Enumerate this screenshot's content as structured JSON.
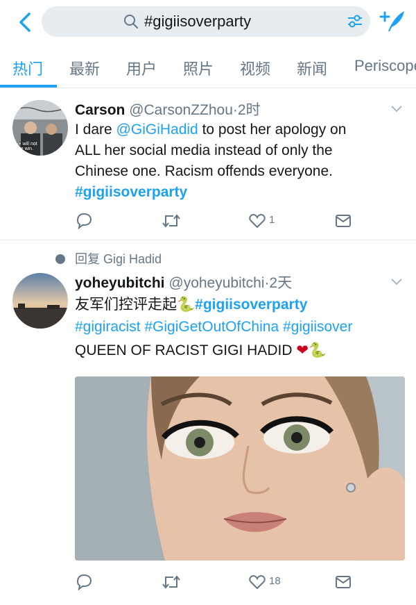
{
  "search": {
    "query": "#gigiisoverparty"
  },
  "tabs": [
    {
      "label": "热门"
    },
    {
      "label": "最新"
    },
    {
      "label": "用户"
    },
    {
      "label": "照片"
    },
    {
      "label": "视频"
    },
    {
      "label": "新闻"
    },
    {
      "label": "Periscope"
    }
  ],
  "tweets": [
    {
      "name": "Carson",
      "handle": "@CarsonZZhou",
      "time": "·2时",
      "avatar_caption": "We will not hate win.",
      "lines": [
        {
          "before": "I dare ",
          "mention": "@GiGiHadid",
          "after": " to post her apology on"
        },
        {
          "text": "ALL her social media instead of only the"
        },
        {
          "text": "Chinese one. Racism offends everyone."
        },
        {
          "hashtag": "#gigiisoverparty"
        }
      ],
      "likes": "1"
    },
    {
      "reply_to": "回复 Gigi Hadid",
      "name": "yoheyubitchi",
      "handle": "@yoheyubitchi",
      "time": "·2天",
      "lines": [
        {
          "before": "友军们控评走起",
          "emoji": "🐍",
          "hashtag": "#gigiisoverparty"
        },
        {
          "text": "#gigiracist #GigiGetOutOfChina #gigiisover"
        },
        {
          "text": "QUEEN OF RACIST GIGI HADID",
          "emoji": "❤🐍"
        }
      ],
      "likes": "18"
    }
  ],
  "colors": {
    "accent": "#1da1f2",
    "secondary": "#657786",
    "divider": "#e1e8ed",
    "search_bg": "#e6ecf0"
  }
}
